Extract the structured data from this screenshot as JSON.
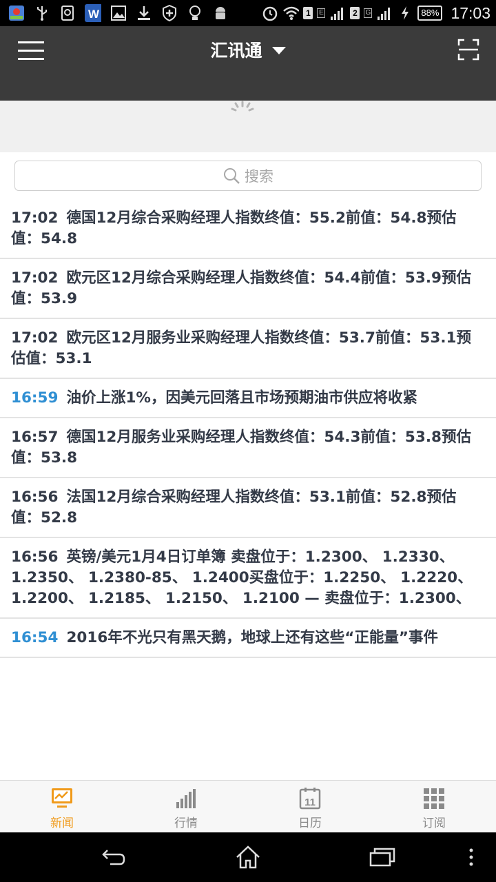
{
  "status_bar": {
    "time": "17:03",
    "battery": "88%",
    "sim1": "1",
    "sim2": "2",
    "net1": "E",
    "net2": "G",
    "icons": [
      "map-app-icon",
      "usb-icon",
      "sim-card-icon",
      "word-app-icon",
      "image-icon",
      "download-icon",
      "shield-icon",
      "bulb-icon",
      "android-icon",
      "alarm-icon",
      "wifi-icon",
      "signal-icon",
      "charging-icon"
    ]
  },
  "header": {
    "title": "汇讯通",
    "icons": {
      "menu": "menu-icon",
      "dropdown": "chevron-down-icon",
      "scan": "scan-icon"
    }
  },
  "search": {
    "placeholder": "搜索",
    "icon": "search-icon"
  },
  "news": [
    {
      "time": "17:02",
      "text": "德国12月综合采购经理人指数终值：55.2前值：54.8预估值：54.8",
      "highlight": false
    },
    {
      "time": "17:02",
      "text": "欧元区12月综合采购经理人指数终值：54.4前值：53.9预估值：53.9",
      "highlight": false
    },
    {
      "time": "17:02",
      "text": "欧元区12月服务业采购经理人指数终值：53.7前值：53.1预估值：53.1",
      "highlight": false
    },
    {
      "time": "16:59",
      "text": "油价上涨1%，因美元回落且市场预期油市供应将收紧",
      "highlight": true
    },
    {
      "time": "16:57",
      "text": "德国12月服务业采购经理人指数终值：54.3前值：53.8预估值：53.8",
      "highlight": false
    },
    {
      "time": "16:56",
      "text": "法国12月综合采购经理人指数终值：53.1前值：52.8预估值：52.8",
      "highlight": false
    },
    {
      "time": "16:56",
      "text": "英镑/美元1月4日订单簿 卖盘位于：1.2300、 1.2330、 1.2350、 1.2380-85、 1.2400买盘位于：1.2250、 1.2220、 1.2200、 1.2185、 1.2150、 1.2100 — 卖盘位于：1.2300、",
      "highlight": false
    },
    {
      "time": "16:54",
      "text": "2016年不光只有黑天鹅，地球上还有这些“正能量”事件",
      "highlight": true
    }
  ],
  "tabs": [
    {
      "label": "新闻",
      "icon": "news-monitor-icon",
      "active": true
    },
    {
      "label": "行情",
      "icon": "bar-chart-icon",
      "active": false
    },
    {
      "label": "日历",
      "icon": "calendar-icon",
      "active": false,
      "icon_text": "11"
    },
    {
      "label": "订阅",
      "icon": "grid-icon",
      "active": false
    }
  ],
  "colors": {
    "appbar": "#3b3b3b",
    "highlight_time": "#2f8fd3",
    "active_tab": "#f09a1a",
    "text": "#333a47"
  },
  "system_nav": [
    "back-icon",
    "home-icon",
    "recents-icon",
    "overflow-menu-icon"
  ]
}
